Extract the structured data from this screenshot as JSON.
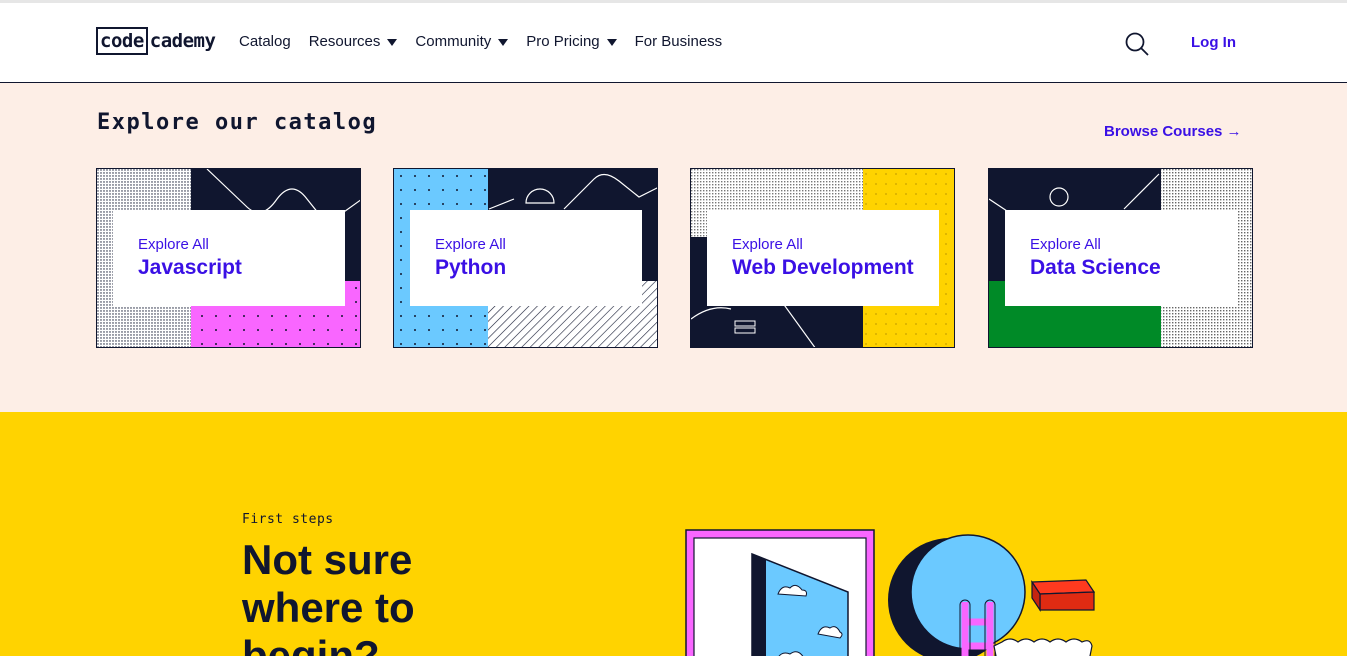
{
  "header": {
    "logo": {
      "box_text": "code",
      "rest_text": "cademy"
    },
    "nav": [
      {
        "label": "Catalog",
        "dropdown": false
      },
      {
        "label": "Resources",
        "dropdown": true
      },
      {
        "label": "Community",
        "dropdown": true
      },
      {
        "label": "Pro Pricing",
        "dropdown": true
      },
      {
        "label": "For Business",
        "dropdown": false
      }
    ],
    "search_icon": "search-icon",
    "login_label": "Log In"
  },
  "catalog": {
    "title": "Explore our catalog",
    "browse_label": "Browse Courses →",
    "cards": [
      {
        "small": "Explore All",
        "big": "Javascript"
      },
      {
        "small": "Explore All",
        "big": "Python"
      },
      {
        "small": "Explore All",
        "big": "Web Development"
      },
      {
        "small": "Explore All",
        "big": "Data Science"
      }
    ]
  },
  "first_steps": {
    "kicker": "First steps",
    "title": "Not sure where to begin?"
  },
  "colors": {
    "navy": "#10162f",
    "accent": "#3a10e5",
    "catalog_bg": "#fdeee6",
    "yellow": "#ffd300",
    "pink": "#f966ff",
    "blue": "#6bc9ff",
    "green": "#008a27"
  }
}
